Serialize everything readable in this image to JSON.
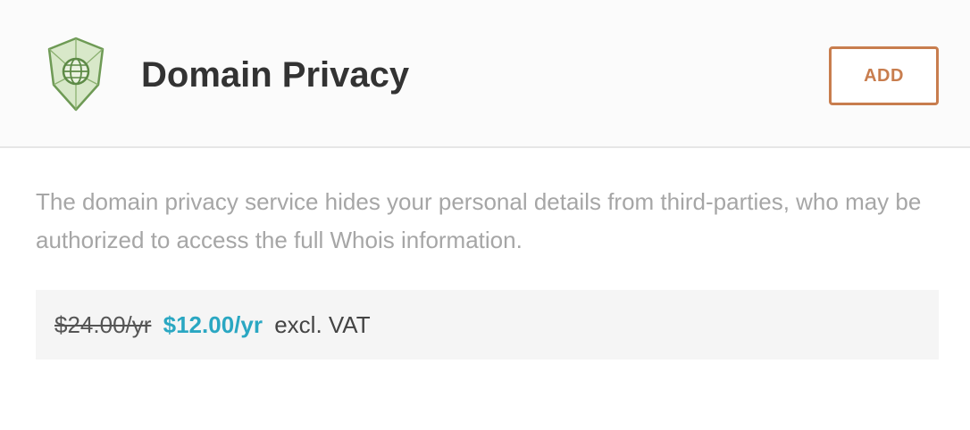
{
  "product": {
    "title": "Domain Privacy",
    "icon": "shield-globe-icon",
    "add_label": "ADD",
    "description": "The domain privacy service hides your personal details from third-parties, who may be authorized to access the full Whois information."
  },
  "pricing": {
    "old_price": "$24.00/yr",
    "new_price": "$12.00/yr",
    "tax_note": "excl. VAT"
  },
  "colors": {
    "accent": "#c87d4e",
    "price": "#2aa7c2",
    "shield": "#6e9a55"
  }
}
